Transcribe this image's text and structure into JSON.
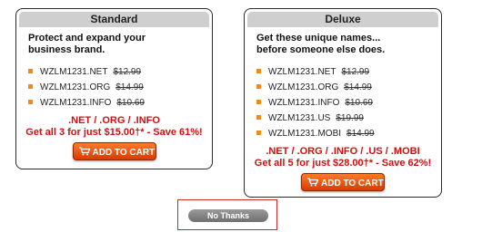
{
  "standard": {
    "title": "Standard",
    "tagline_line1": "Protect and expand your",
    "tagline_line2": "business brand.",
    "domains": [
      {
        "name": "WZLM1231.NET",
        "price": "$12.99"
      },
      {
        "name": "WZLM1231.ORG",
        "price": "$14.99"
      },
      {
        "name": "WZLM1231.INFO",
        "price": "$10.69"
      }
    ],
    "extensions": ".NET / .ORG / .INFO",
    "deal": "Get all 3 for just $15.00†* - Save 61%!",
    "cart_label": "ADD TO CART"
  },
  "deluxe": {
    "title": "Deluxe",
    "tagline_line1": "Get these unique names...",
    "tagline_line2": "before someone else does.",
    "domains": [
      {
        "name": "WZLM1231.NET",
        "price": "$12.99"
      },
      {
        "name": "WZLM1231.ORG",
        "price": "$14.99"
      },
      {
        "name": "WZLM1231.INFO",
        "price": "$10.69"
      },
      {
        "name": "WZLM1231.US",
        "price": "$19.99"
      },
      {
        "name": "WZLM1231.MOBI",
        "price": "$14.99"
      }
    ],
    "extensions": ".NET / .ORG / .INFO / .US / .MOBI",
    "deal": "Get all 5 for just $28.00†* - Save 62%!",
    "cart_label": "ADD TO CART"
  },
  "no_thanks_label": "No Thanks",
  "colors": {
    "accent": "#d01010",
    "bullet": "#f08a1c",
    "button": "#e85a10"
  },
  "icons": {
    "cart": "shopping-cart-icon"
  }
}
